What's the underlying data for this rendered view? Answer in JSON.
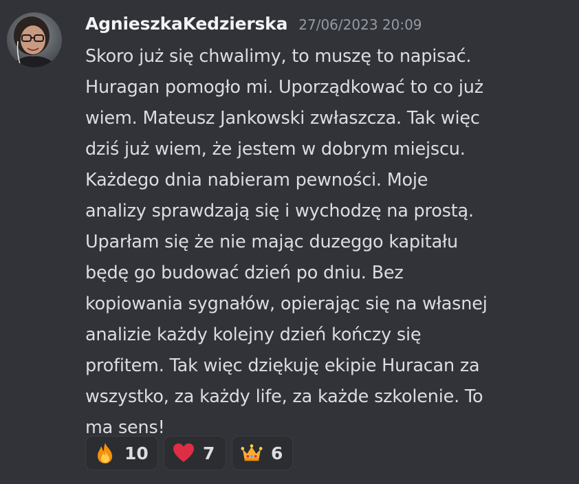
{
  "message": {
    "username": "AgnieszkaKedzierska",
    "timestamp": "27/06/2023 20:09",
    "lines": [
      "Skoro już się chwalimy, to muszę to napisać.",
      "Huragan pomogło mi. Uporządkować to co już",
      "wiem. Mateusz Jankowski zwłaszcza. Tak więc",
      "dziś już wiem, że jestem w dobrym miejscu.",
      "Każdego dnia nabieram pewności. Moje",
      "analizy sprawdzają się i wychodzę na prostą.",
      "Uparłam się że nie mając duzeggo kapitału",
      "będę go budować dzień po dniu. Bez",
      "kopiowania sygnałów, opierając się na własnej",
      "analizie każdy kolejny dzień kończy się",
      "profitem. Tak więc dziękuję ekipie Huracan za",
      "wszystko, za każdy life, za każde szkolenie. To",
      "ma sens!"
    ]
  },
  "reactions": [
    {
      "icon": "fire-icon",
      "count": "10"
    },
    {
      "icon": "heart-icon",
      "count": "7"
    },
    {
      "icon": "crown-icon",
      "count": "6"
    }
  ],
  "colors": {
    "background": "#313338",
    "username": "#f2f3f5",
    "timestamp": "#949ba4",
    "text": "#dbdee1",
    "reaction_bg": "#2b2d31"
  }
}
